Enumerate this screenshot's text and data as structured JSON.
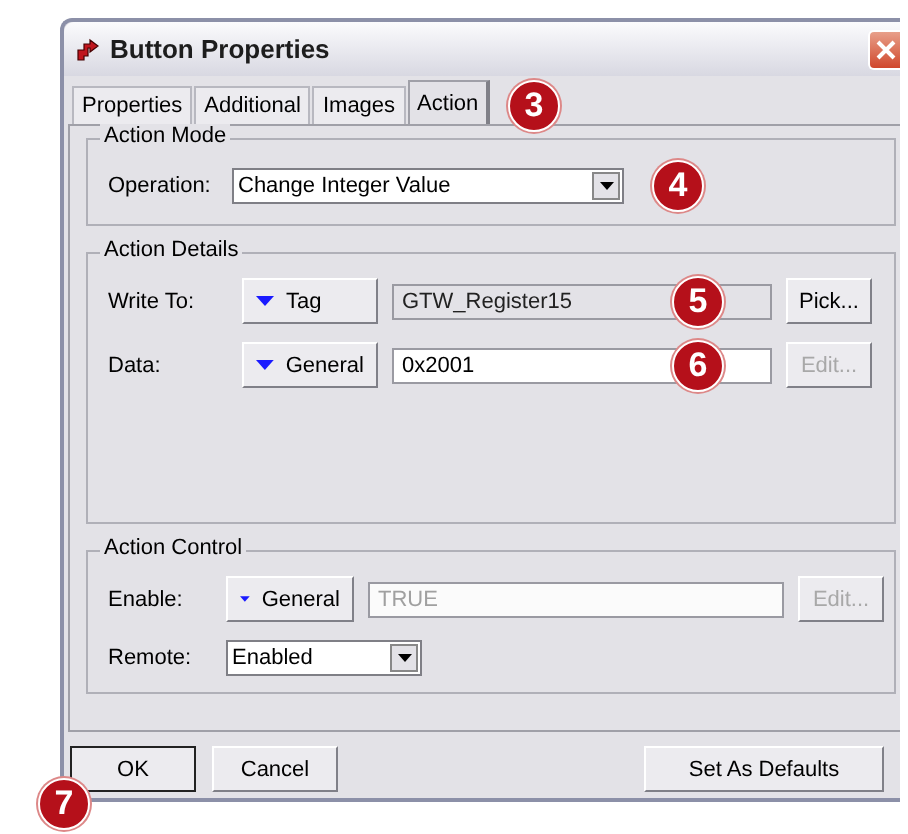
{
  "window": {
    "title": "Button Properties"
  },
  "tabs": {
    "callout": "3",
    "items": [
      {
        "label": "Properties",
        "selected": false
      },
      {
        "label": "Additional",
        "selected": false
      },
      {
        "label": "Images",
        "selected": false
      },
      {
        "label": "Action",
        "selected": true
      }
    ]
  },
  "action_mode": {
    "title": "Action Mode",
    "label": "Operation:",
    "value": "Change Integer Value",
    "callout": "4"
  },
  "action_details": {
    "title": "Action Details",
    "rows": [
      {
        "kind": "source",
        "label": "Write To:",
        "source": "Tag",
        "value": "GTW_Register15",
        "read_only": true,
        "disabled": false,
        "button": "Pick...",
        "button_disabled": false,
        "callout": "5"
      },
      {
        "kind": "source",
        "label": "Data:",
        "source": "General",
        "value": "0x2001",
        "read_only": false,
        "disabled": false,
        "button": "Edit...",
        "button_disabled": true,
        "callout": "6"
      }
    ]
  },
  "action_control": {
    "title": "Action Control",
    "rows": [
      {
        "kind": "source",
        "label": "Enable:",
        "source": "General",
        "value": "TRUE",
        "read_only": false,
        "disabled": true,
        "button": "Edit...",
        "button_disabled": true
      },
      {
        "kind": "dropdown",
        "label": "Remote:",
        "value": "Enabled"
      }
    ]
  },
  "buttons": [
    {
      "label": "OK",
      "default": true,
      "callout": "7"
    },
    {
      "label": "Cancel",
      "default": false
    },
    {
      "label": "Set As Defaults",
      "default": false
    }
  ]
}
